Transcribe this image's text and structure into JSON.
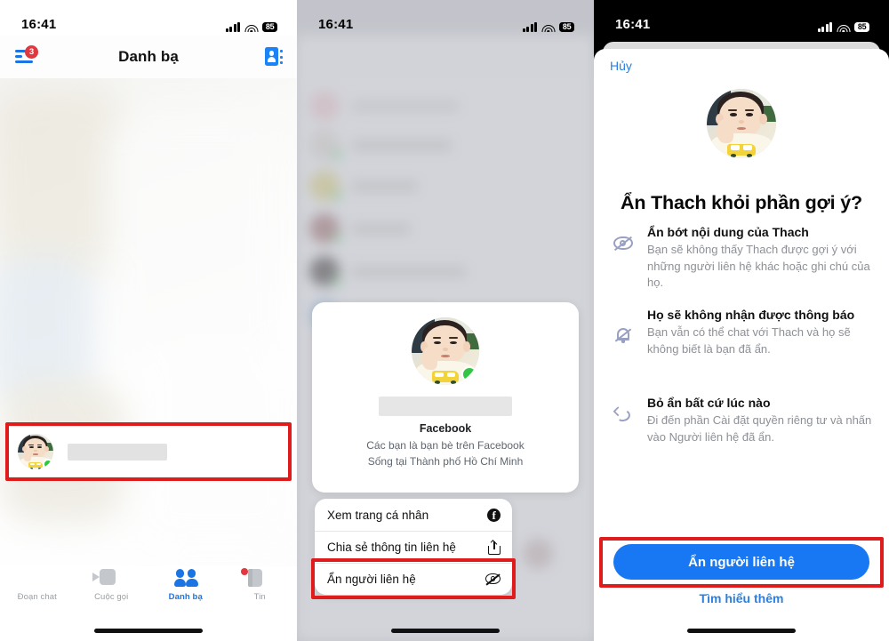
{
  "status_bar": {
    "time": "16:41",
    "battery": "85",
    "signal_icon": "cellular-bars-icon",
    "wifi_icon": "wifi-icon"
  },
  "panel1": {
    "title": "Danh bạ",
    "menu_badge": "3",
    "menu_icon": "hamburger-menu-icon",
    "contacts_icon": "contacts-book-icon",
    "contact_row": {
      "avatar_name": "baby-avatar",
      "presence": "online",
      "name_redacted": true
    },
    "tabs": [
      {
        "label": "Đoạn chat",
        "icon": "chat-bubble-icon",
        "active": false
      },
      {
        "label": "Cuộc gọi",
        "icon": "video-camera-icon",
        "active": false
      },
      {
        "label": "Danh bạ",
        "icon": "people-icon",
        "active": true
      },
      {
        "label": "Tin",
        "icon": "stories-icon",
        "active": false,
        "badge": true
      }
    ]
  },
  "panel2": {
    "card": {
      "source_label": "Facebook",
      "subtitle_line1": "Các bạn là bạn bè trên Facebook",
      "subtitle_line2": "Sống tại Thành phố Hồ Chí Minh",
      "avatar_name": "baby-avatar",
      "presence": "online"
    },
    "menu_items": [
      {
        "label": "Xem trang cá nhân",
        "icon": "facebook-icon",
        "highlighted": false
      },
      {
        "label": "Chia sẻ thông tin liên hệ",
        "icon": "share-icon",
        "highlighted": false
      },
      {
        "label": "Ẩn người liên hệ",
        "icon": "eye-slash-icon",
        "highlighted": true
      }
    ]
  },
  "panel3": {
    "cancel_label": "Hủy",
    "title": "Ẩn Thach khỏi phần gợi ý?",
    "avatar_name": "baby-avatar",
    "items": [
      {
        "icon": "eye-slash-icon",
        "heading": "Ẩn bớt nội dung của Thach",
        "description": "Bạn sẽ không thấy Thach được gợi ý với những người liên hệ khác hoặc ghi chú của họ."
      },
      {
        "icon": "bell-slash-icon",
        "heading": "Họ sẽ không nhận được thông báo",
        "description": "Bạn vẫn có thể chat với Thach và họ sẽ không biết là bạn đã ẩn."
      },
      {
        "icon": "undo-arrow-icon",
        "heading": "Bỏ ẩn bất cứ lúc nào",
        "description": "Đi đến phần Cài đặt quyền riêng tư và nhấn vào Người liên hệ đã ẩn."
      }
    ],
    "primary_button": "Ẩn người liên hệ",
    "learn_more": "Tìm hiểu thêm"
  },
  "colors": {
    "accent_blue": "#1877f2",
    "link_blue": "#2a7fe0",
    "highlight_red": "#e01b1b",
    "presence_green": "#31c543",
    "badge_red": "#e0383e"
  }
}
